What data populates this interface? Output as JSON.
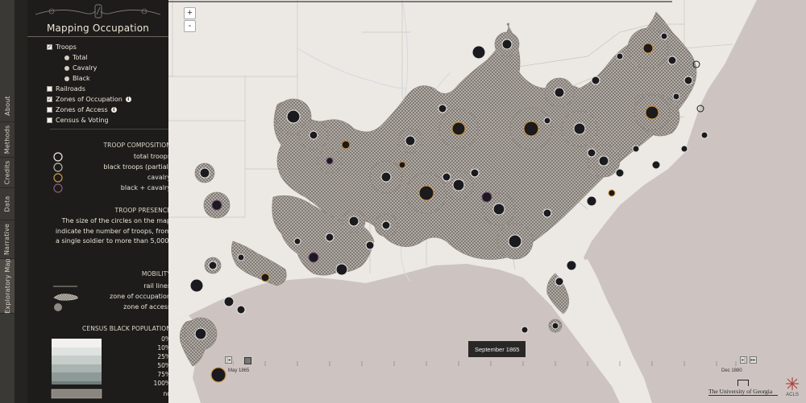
{
  "tabs": [
    {
      "label": "Exploratory Map",
      "active": true
    },
    {
      "label": "Narrative"
    },
    {
      "label": "Data"
    },
    {
      "label": "Credits"
    },
    {
      "label": "Methods"
    },
    {
      "label": "About"
    }
  ],
  "panel": {
    "title": "Mapping Occupation",
    "layers": {
      "troops": "Troops",
      "troop_options": [
        "Total",
        "Cavalry",
        "Black"
      ],
      "railroads": "Railroads",
      "zones_occupation": "Zones of Occupation",
      "zones_access": "Zones of Access",
      "census_voting": "Census & Voting"
    },
    "troop_composition": {
      "heading": "TROOP COMPOSITION",
      "items": [
        "total troops",
        "black troops (partial)",
        "cavalry",
        "black + cavalry"
      ]
    },
    "troop_presence": {
      "heading": "TROOP PRESENCE",
      "text": "The size of the circles on the map indicate the number of troops, from a single soldier to more than 5,000."
    },
    "mobility": {
      "heading": "MOBILITY",
      "items": [
        "rail lines",
        "zone of occupation",
        "zone of access"
      ]
    },
    "census": {
      "heading": "CENSUS BLACK POPULATION",
      "levels": [
        "0%",
        "10%",
        "25%",
        "50%",
        "75%",
        "100%"
      ],
      "nd": "nd",
      "colors": [
        "#f3f1ee",
        "#dfe3e0",
        "#c6cdca",
        "#a9b4b1",
        "#8d9a97",
        "#6f7d7a"
      ]
    }
  },
  "map": {
    "zoom_in": "+",
    "zoom_out": "-",
    "current_date": "September 1865",
    "slider_start": "May 1865",
    "slider_end": "Dec 1880",
    "institution": "The University of Georgia",
    "partner": "ACLS",
    "colors": {
      "land": "#ece9e5",
      "sea": "#cdc4c2",
      "zone": "#b9b2ad",
      "zone_edge": "#7a736e",
      "troop": "#1a1a1f",
      "cavalry": "#d69a3a",
      "black_cavalry": "#7a4d7a"
    }
  }
}
